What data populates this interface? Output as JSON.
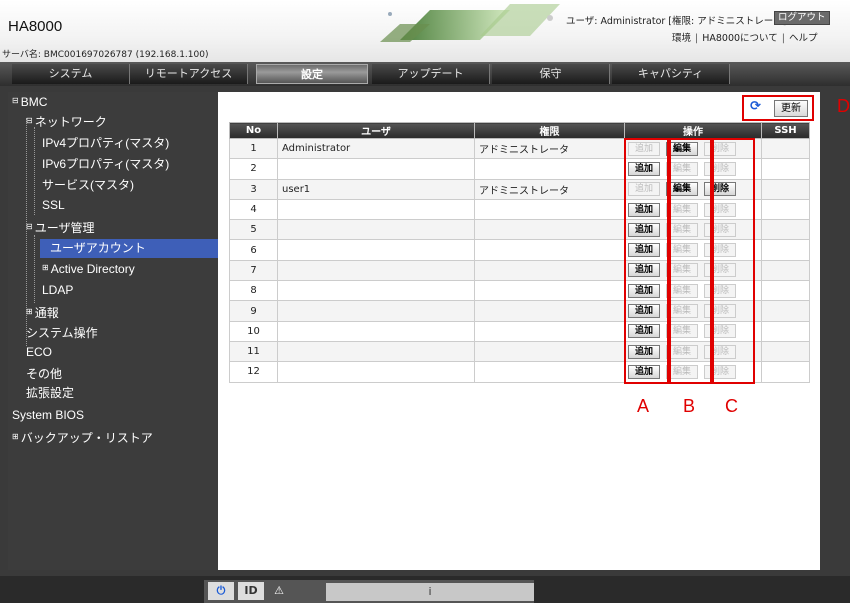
{
  "header": {
    "app_title": "HA8000",
    "server_name": "サーバ名: BMC001697026787 (192.168.1.100)",
    "user_info": "ユーザ: Administrator [権限: アドミニストレータ]",
    "logout": "ログアウト",
    "links": [
      "環境",
      "HA8000について",
      "ヘルプ"
    ]
  },
  "tabs": [
    "システム",
    "リモートアクセス",
    "設定",
    "アップデート",
    "保守",
    "キャパシティ"
  ],
  "active_tab": "設定",
  "sidebar": {
    "items": [
      {
        "label": "BMC",
        "expander": "⊟"
      },
      {
        "label": "ネットワーク",
        "expander": "⊟"
      },
      {
        "label": "IPv4プロパティ(マスタ)"
      },
      {
        "label": "IPv6プロパティ(マスタ)"
      },
      {
        "label": "サービス(マスタ)"
      },
      {
        "label": "SSL"
      },
      {
        "label": "ユーザ管理",
        "expander": "⊟"
      },
      {
        "label": "ユーザアカウント",
        "active": true
      },
      {
        "label": "Active Directory",
        "expander": "⊞"
      },
      {
        "label": "LDAP"
      },
      {
        "label": "通報",
        "expander": "⊞"
      },
      {
        "label": "システム操作"
      },
      {
        "label": "ECO"
      },
      {
        "label": "その他"
      },
      {
        "label": "拡張設定"
      },
      {
        "label": "System BIOS"
      },
      {
        "label": "バックアップ・リストア",
        "expander": "⊞"
      }
    ]
  },
  "refresh": {
    "label": "更新",
    "icon": "refresh-icon"
  },
  "table": {
    "headers": [
      "No",
      "ユーザ",
      "権限",
      "操作",
      "SSH"
    ],
    "op_labels": {
      "add": "追加",
      "edit": "編集",
      "delete": "削除"
    },
    "rows": [
      {
        "no": "1",
        "user": "Administrator",
        "role": "アドミニストレータ",
        "add": false,
        "edit": true,
        "del": false
      },
      {
        "no": "2",
        "user": "",
        "role": "",
        "add": true,
        "edit": false,
        "del": false
      },
      {
        "no": "3",
        "user": "user1",
        "role": "アドミニストレータ",
        "add": false,
        "edit": true,
        "del": true
      },
      {
        "no": "4",
        "user": "",
        "role": "",
        "add": true,
        "edit": false,
        "del": false
      },
      {
        "no": "5",
        "user": "",
        "role": "",
        "add": true,
        "edit": false,
        "del": false
      },
      {
        "no": "6",
        "user": "",
        "role": "",
        "add": true,
        "edit": false,
        "del": false
      },
      {
        "no": "7",
        "user": "",
        "role": "",
        "add": true,
        "edit": false,
        "del": false
      },
      {
        "no": "8",
        "user": "",
        "role": "",
        "add": true,
        "edit": false,
        "del": false
      },
      {
        "no": "9",
        "user": "",
        "role": "",
        "add": true,
        "edit": false,
        "del": false
      },
      {
        "no": "10",
        "user": "",
        "role": "",
        "add": true,
        "edit": false,
        "del": false
      },
      {
        "no": "11",
        "user": "",
        "role": "",
        "add": true,
        "edit": false,
        "del": false
      },
      {
        "no": "12",
        "user": "",
        "role": "",
        "add": true,
        "edit": false,
        "del": false
      }
    ]
  },
  "callouts": {
    "a": "A",
    "b": "B",
    "c": "C",
    "d": "D"
  },
  "footer": {
    "power_icon": "power-icon",
    "id_label": "ID",
    "warning_icon": "warning-icon",
    "status_info": "i"
  },
  "colors": {
    "accent_highlight": "#3e5fb8",
    "annotation_red": "#e00000"
  }
}
